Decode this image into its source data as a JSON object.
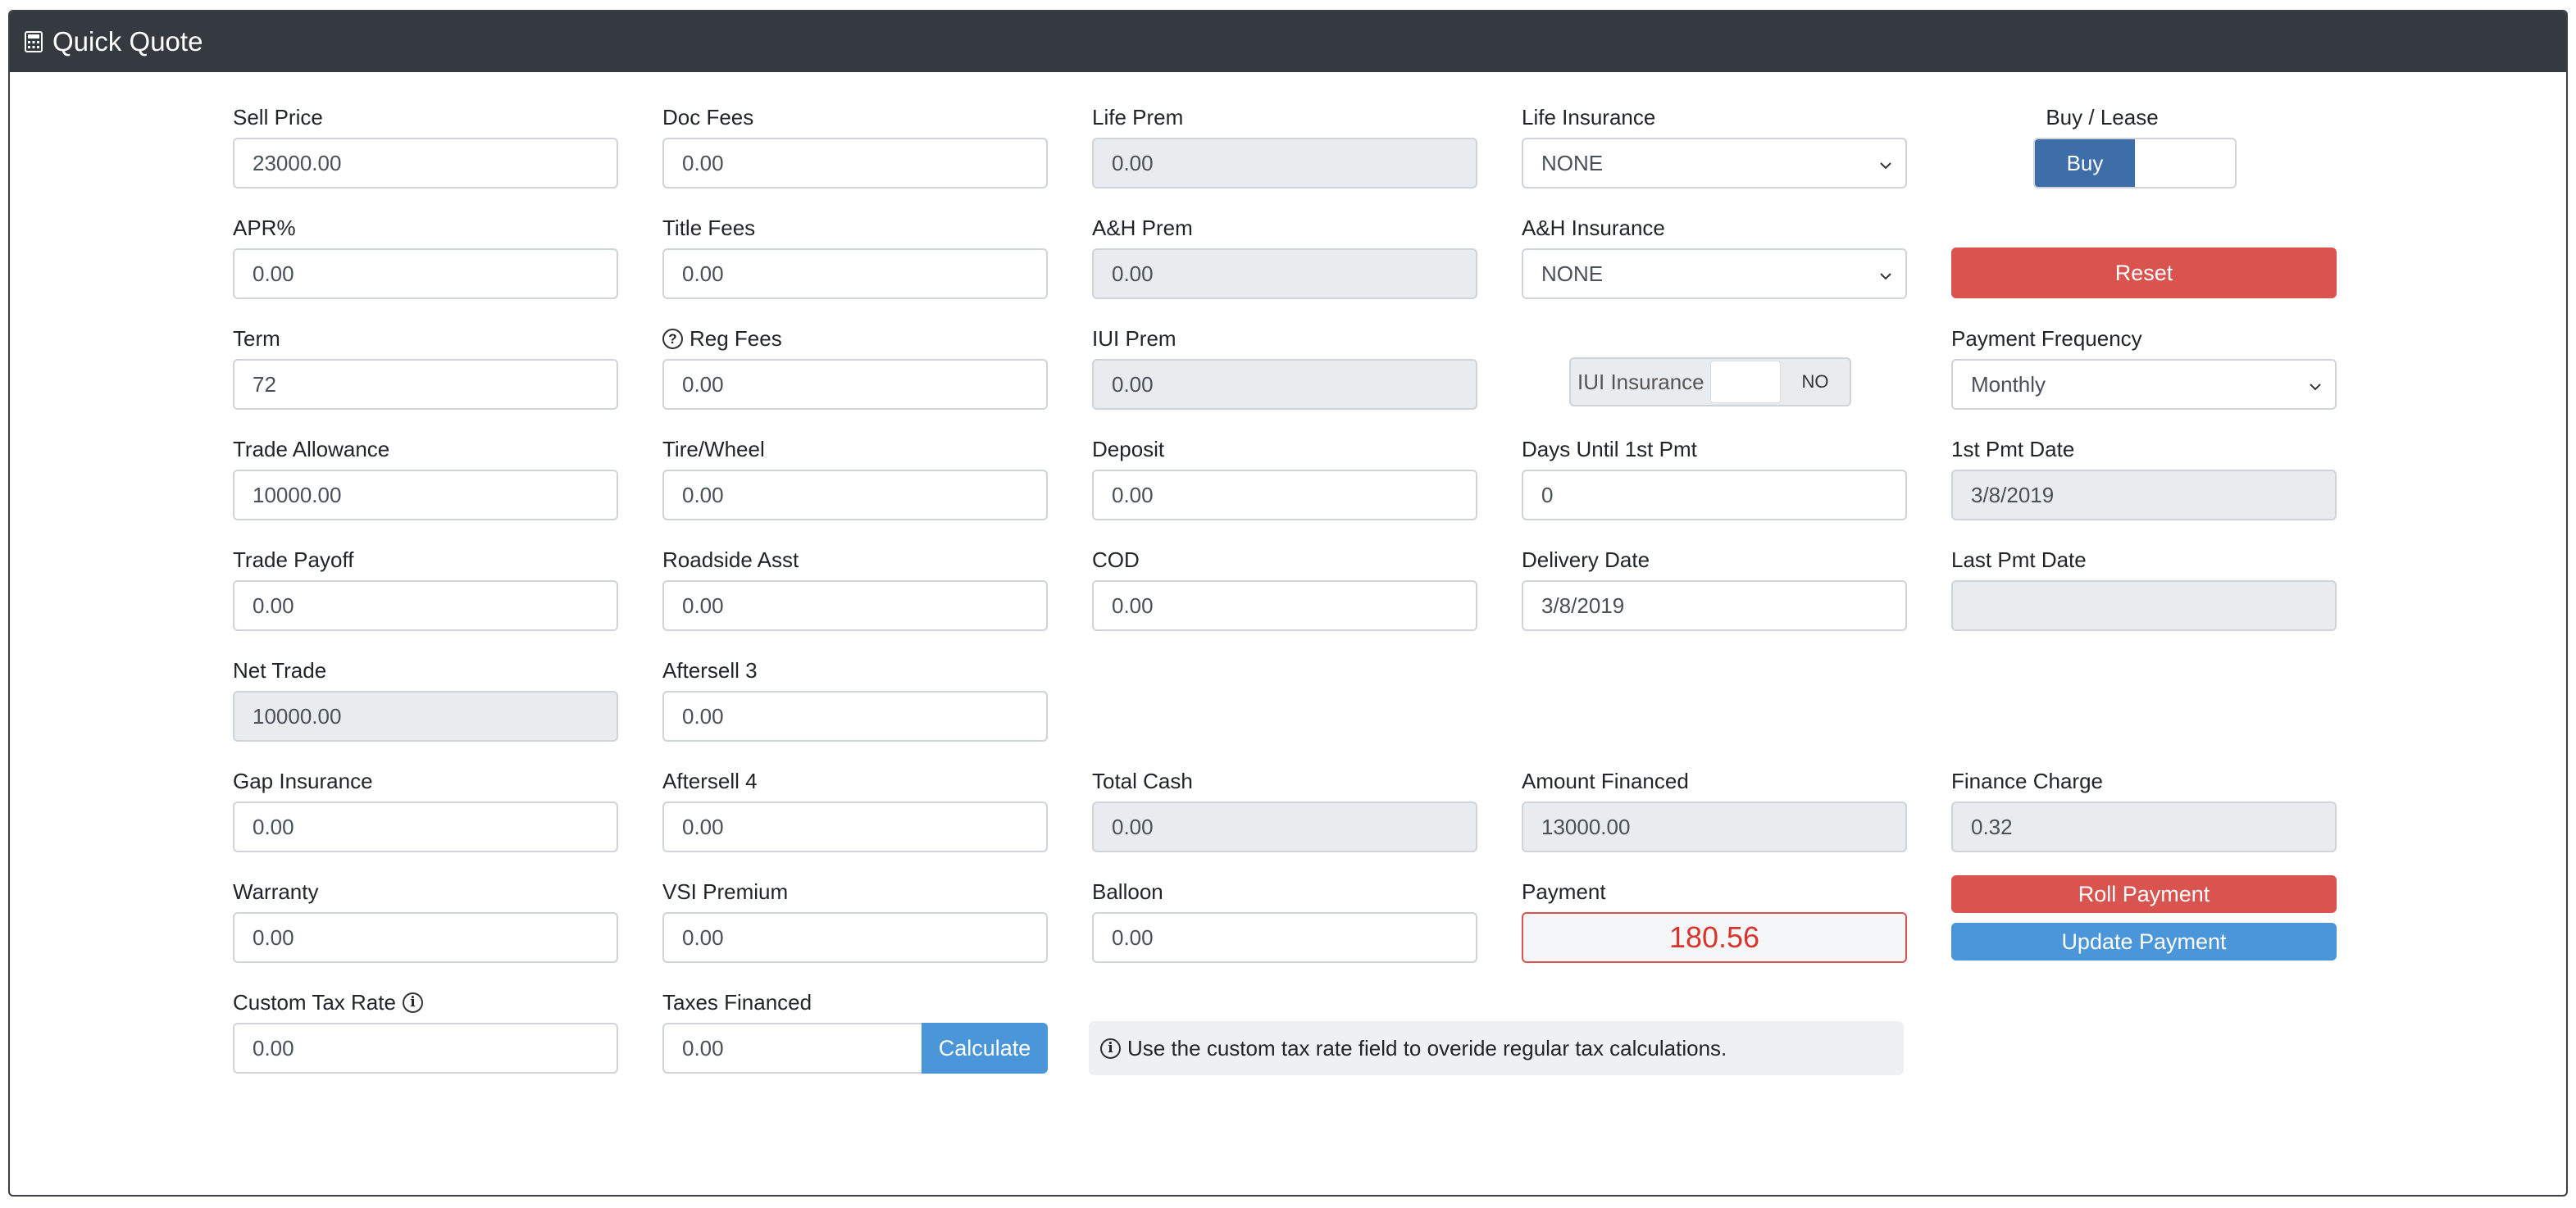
{
  "header": {
    "title": "Quick Quote",
    "icon": "calculator-icon"
  },
  "col1": {
    "sell_price": {
      "label": "Sell Price",
      "value": "23000.00"
    },
    "apr": {
      "label": "APR%",
      "value": "0.00"
    },
    "term": {
      "label": "Term",
      "value": "72"
    },
    "trade_allowance": {
      "label": "Trade Allowance",
      "value": "10000.00"
    },
    "trade_payoff": {
      "label": "Trade Payoff",
      "value": "0.00"
    },
    "net_trade": {
      "label": "Net Trade",
      "value": "10000.00"
    },
    "gap_insurance": {
      "label": "Gap Insurance",
      "value": "0.00"
    },
    "warranty": {
      "label": "Warranty",
      "value": "0.00"
    },
    "custom_tax_rate": {
      "label": "Custom Tax Rate",
      "value": "0.00"
    }
  },
  "col2": {
    "doc_fees": {
      "label": "Doc Fees",
      "value": "0.00"
    },
    "title_fees": {
      "label": "Title Fees",
      "value": "0.00"
    },
    "reg_fees": {
      "label": "Reg Fees",
      "value": "0.00"
    },
    "tire_wheel": {
      "label": "Tire/Wheel",
      "value": "0.00"
    },
    "roadside": {
      "label": "Roadside Asst",
      "value": "0.00"
    },
    "aftersell3": {
      "label": "Aftersell 3",
      "value": "0.00"
    },
    "aftersell4": {
      "label": "Aftersell 4",
      "value": "0.00"
    },
    "vsi_premium": {
      "label": "VSI Premium",
      "value": "0.00"
    },
    "taxes_financed": {
      "label": "Taxes Financed",
      "value": "0.00",
      "button": "Calculate"
    }
  },
  "col3": {
    "life_prem": {
      "label": "Life Prem",
      "value": "0.00"
    },
    "ah_prem": {
      "label": "A&H Prem",
      "value": "0.00"
    },
    "iui_prem": {
      "label": "IUI Prem",
      "value": "0.00"
    },
    "deposit": {
      "label": "Deposit",
      "value": "0.00"
    },
    "cod": {
      "label": "COD",
      "value": "0.00"
    },
    "total_cash": {
      "label": "Total Cash",
      "value": "0.00"
    },
    "balloon": {
      "label": "Balloon",
      "value": "0.00"
    }
  },
  "col4": {
    "life_insurance": {
      "label": "Life Insurance",
      "value": "NONE"
    },
    "ah_insurance": {
      "label": "A&H Insurance",
      "value": "NONE"
    },
    "iui_insurance": {
      "label": "IUI Insurance",
      "state": "NO"
    },
    "days_until_pmt": {
      "label": "Days Until 1st Pmt",
      "value": "0"
    },
    "delivery_date": {
      "label": "Delivery Date",
      "value": "3/8/2019"
    },
    "amount_financed": {
      "label": "Amount Financed",
      "value": "13000.00"
    },
    "payment": {
      "label": "Payment",
      "value": "180.56"
    }
  },
  "col5": {
    "buy_lease": {
      "label": "Buy / Lease",
      "selected": "Buy"
    },
    "reset": "Reset",
    "payment_frequency": {
      "label": "Payment Frequency",
      "value": "Monthly"
    },
    "first_pmt_date": {
      "label": "1st Pmt Date",
      "value": "3/8/2019"
    },
    "last_pmt_date": {
      "label": "Last Pmt Date",
      "value": ""
    },
    "finance_charge": {
      "label": "Finance Charge",
      "value": "0.32"
    },
    "roll_payment": "Roll Payment",
    "update_payment": "Update Payment"
  },
  "note": "Use the custom tax rate field to overide regular tax calculations.",
  "colors": {
    "header_bg": "#343a40",
    "primary": "#3d6ea8",
    "danger": "#d9534f",
    "info": "#4a96d8",
    "readonly_bg": "#e9ecef"
  }
}
